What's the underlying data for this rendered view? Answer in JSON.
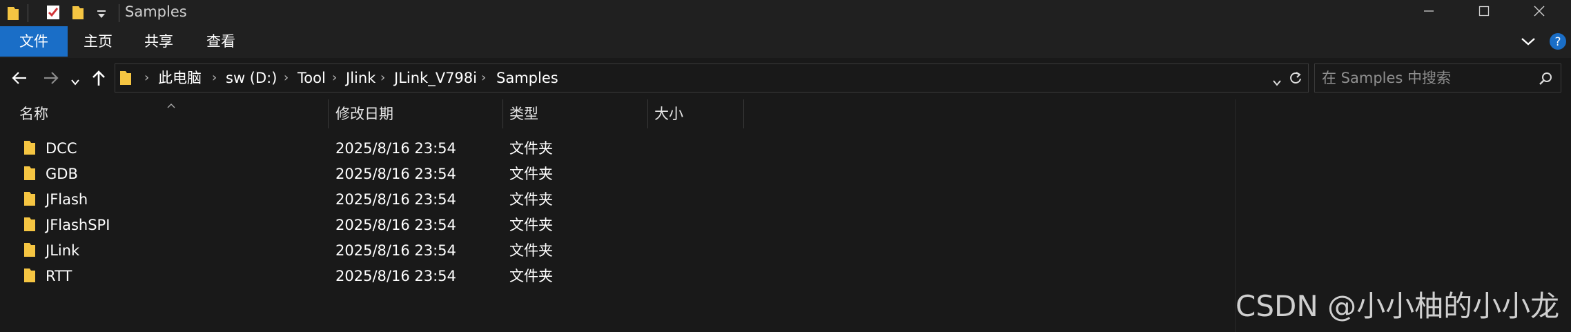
{
  "window": {
    "title": "Samples",
    "controls": [
      "minimize-icon",
      "maximize-icon",
      "close-icon"
    ]
  },
  "ribbon": {
    "tabs": [
      "文件",
      "主页",
      "共享",
      "查看"
    ],
    "active_tab": "文件",
    "accent_color": "#1a6ec7"
  },
  "address_bar": {
    "breadcrumb": [
      "此电脑",
      "sw (D:)",
      "Tool",
      "Jlink",
      "JLink_V798i",
      "Samples"
    ]
  },
  "search": {
    "placeholder": "在 Samples 中搜索"
  },
  "columns": {
    "name": "名称",
    "date": "修改日期",
    "type": "类型",
    "size": "大小"
  },
  "files": [
    {
      "name": "DCC",
      "date": "2025/8/16 23:54",
      "type": "文件夹"
    },
    {
      "name": "GDB",
      "date": "2025/8/16 23:54",
      "type": "文件夹"
    },
    {
      "name": "JFlash",
      "date": "2025/8/16 23:54",
      "type": "文件夹"
    },
    {
      "name": "JFlashSPI",
      "date": "2025/8/16 23:54",
      "type": "文件夹"
    },
    {
      "name": "JLink",
      "date": "2025/8/16 23:54",
      "type": "文件夹"
    },
    {
      "name": "RTT",
      "date": "2025/8/16 23:54",
      "type": "文件夹"
    }
  ],
  "watermark": "CSDN @小小柚的小小龙"
}
